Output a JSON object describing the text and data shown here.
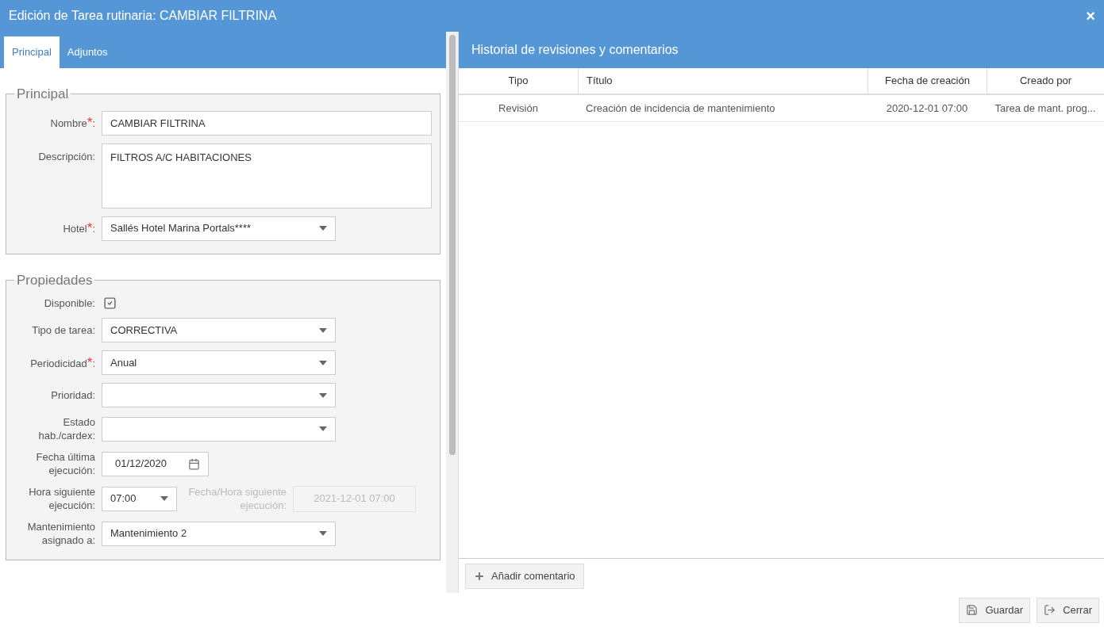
{
  "window": {
    "title": "Edición de Tarea rutinaria: CAMBIAR FILTRINA",
    "close": "×"
  },
  "tabs": [
    {
      "label": "Principal",
      "selected": true
    },
    {
      "label": "Adjuntos",
      "selected": false
    }
  ],
  "sections": [
    {
      "legend": "Principal",
      "fields": [
        {
          "kind": "text",
          "label": "Nombre",
          "required_mark": "*",
          "colon": ":",
          "value": "CAMBIAR FILTRINA"
        },
        {
          "kind": "textarea",
          "label": "Descripción:",
          "value": "FILTROS A/C HABITACIONES"
        },
        {
          "kind": "select",
          "label": "Hotel",
          "required_mark": "*",
          "colon": ":",
          "value": "Sallés Hotel Marina Portals****"
        }
      ]
    },
    {
      "legend": "Propiedades",
      "fields": [
        {
          "kind": "checkbox",
          "label": "Disponible:",
          "checked": true
        },
        {
          "kind": "select",
          "label": "Tipo de tarea:",
          "value": "CORRECTIVA"
        },
        {
          "kind": "select",
          "label": "Periodicidad",
          "required_mark": "*",
          "colon": ":",
          "value": "Anual"
        },
        {
          "kind": "select",
          "label": "Prioridad:"
        },
        {
          "kind": "select",
          "label": "Estado hab./cardex:"
        },
        {
          "kind": "date",
          "label": "Fecha última ejecución:",
          "value": "01/12/2020"
        },
        {
          "kind": "time",
          "label": "Hora siguiente ejecución:",
          "value": "07:00",
          "extra_label": "Fecha/Hora siguiente ejecución:",
          "extra_value": "2021-12-01 07:00"
        },
        {
          "kind": "select",
          "label": "Mantenimiento asignado a:",
          "value": "Mantenimiento 2"
        }
      ]
    }
  ],
  "history": {
    "title": "Historial de revisiones y comentarios",
    "columns": [
      "Tipo",
      "Título",
      "Fecha de creación",
      "Creado por"
    ],
    "rows": [
      [
        "Revisión",
        "Creación de incidencia de mantenimiento",
        "2020-12-01 07:00",
        "Tarea de mant. prog..."
      ]
    ],
    "add_button": "Añadir comentario"
  },
  "buttons": [
    {
      "kind": "save",
      "label": "Guardar"
    },
    {
      "kind": "close",
      "label": "Cerrar"
    }
  ]
}
